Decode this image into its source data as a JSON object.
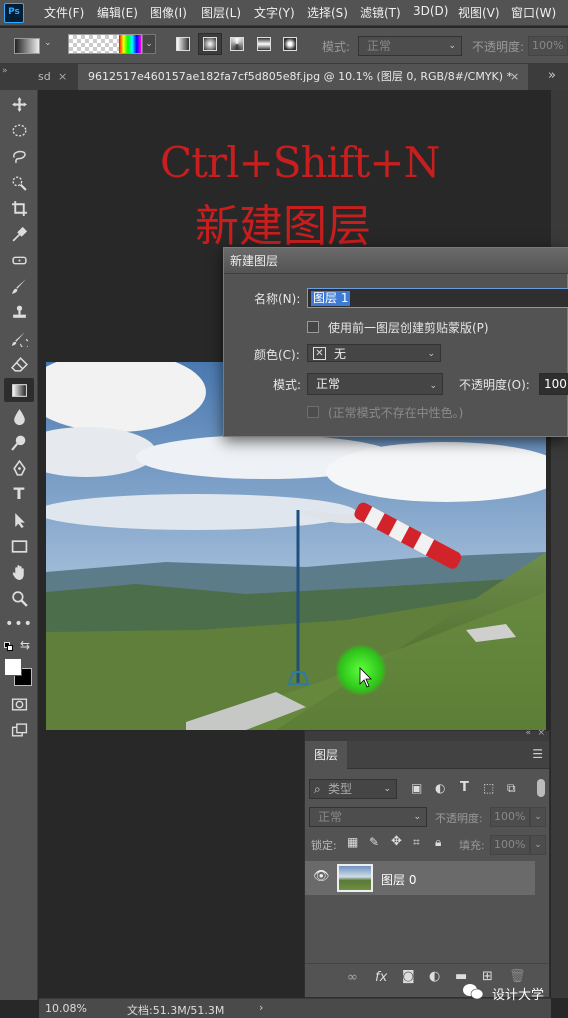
{
  "app": {
    "logo_text": "Ps",
    "name": "Adobe Photoshop"
  },
  "menu": [
    {
      "label": "文件(F)"
    },
    {
      "label": "编辑(E)"
    },
    {
      "label": "图像(I)"
    },
    {
      "label": "图层(L)"
    },
    {
      "label": "文字(Y)"
    },
    {
      "label": "选择(S)"
    },
    {
      "label": "滤镜(T)"
    },
    {
      "label": "3D(D)"
    },
    {
      "label": "视图(V)"
    },
    {
      "label": "窗口(W)"
    }
  ],
  "options_bar": {
    "mode_label": "模式:",
    "mode_value": "正常",
    "opacity_label": "不透明度:",
    "opacity_value": "100%"
  },
  "tabs": [
    {
      "label": "sd",
      "close": "×"
    },
    {
      "label": "9612517e460157ae182fa7cf5d805e8f.jpg @ 10.1% (图层 0, RGB/8#/CMYK) *",
      "close": "×"
    }
  ],
  "tabbar_more": "»",
  "overlay": {
    "shortcut": "Ctrl+Shift+N",
    "title": "新建图层"
  },
  "dialog": {
    "title": "新建图层",
    "name_label": "名称(N):",
    "name_value": "图层 1",
    "clip_label": "使用前一图层创建剪贴蒙版(P)",
    "color_label": "颜色(C):",
    "color_value": "无",
    "mode_label": "模式:",
    "mode_value": "正常",
    "opacity_label": "不透明度(O):",
    "opacity_value": "100",
    "neutral_label": "(正常模式不存在中性色。)"
  },
  "layers_panel": {
    "tab_label": "图层",
    "filter_placeholder": "类型",
    "blend_mode": "正常",
    "opacity_label": "不透明度:",
    "opacity_value": "100%",
    "lock_label": "锁定:",
    "fill_label": "填充:",
    "fill_value": "100%",
    "layers": [
      {
        "name": "图层 0",
        "visible": true
      }
    ],
    "footer_fx": "fx"
  },
  "status": {
    "zoom": "10.08%",
    "doc_size": "文档:51.3M/51.3M",
    "arrow": "›"
  },
  "watermark": {
    "text": "设计大学"
  },
  "colors": {
    "ui_bg": "#535353",
    "canvas_bg": "#282828",
    "overlay_red": "#c81e1e",
    "selection_blue": "#3f7bd4",
    "cursor_green": "#3cd21e"
  },
  "tools": [
    "move-tool-icon",
    "marquee-tool-icon",
    "lasso-tool-icon",
    "quick-select-tool-icon",
    "crop-tool-icon",
    "eyedropper-tool-icon",
    "healing-brush-tool-icon",
    "brush-tool-icon",
    "clone-stamp-tool-icon",
    "history-brush-tool-icon",
    "eraser-tool-icon",
    "gradient-tool-icon",
    "blur-tool-icon",
    "dodge-tool-icon",
    "pen-tool-icon",
    "type-tool-icon",
    "path-select-tool-icon",
    "rectangle-tool-icon",
    "hand-tool-icon",
    "zoom-tool-icon"
  ]
}
